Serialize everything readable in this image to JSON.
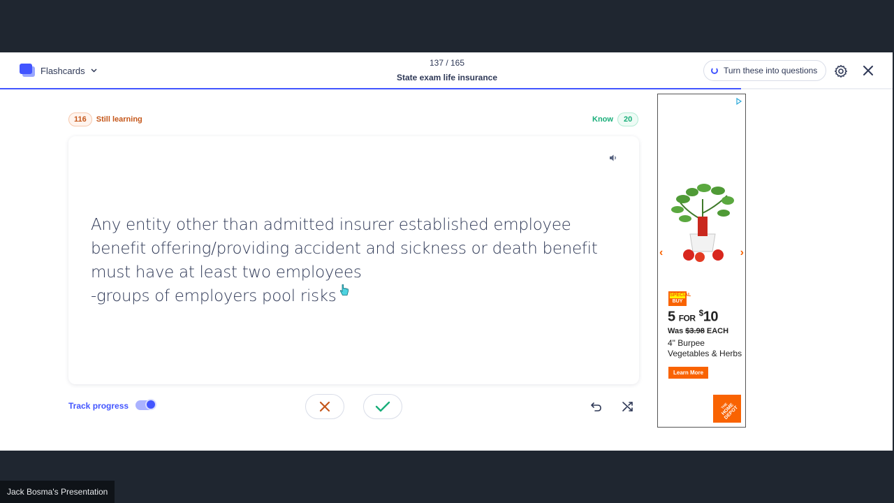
{
  "header": {
    "mode_label": "Flashcards",
    "counter": "137 / 165",
    "deck_title": "State exam life insurance",
    "turn_into_questions": "Turn these into questions",
    "progress_fraction": 0.83
  },
  "tally": {
    "still_learning_count": "116",
    "still_learning_label": "Still learning",
    "know_label": "Know",
    "know_count": "20"
  },
  "card": {
    "text": "Any entity other than admitted insurer established employee\nbenefit offering/providing accident and sickness or death benefit\nmust have at least two employees\n-groups of employers pool risks"
  },
  "footer": {
    "track_progress_label": "Track progress",
    "track_progress_on": true
  },
  "ad": {
    "special_top": "SPECIAL",
    "special_bottom": "BUY",
    "price_qty": "5",
    "price_for": "FOR",
    "price_currency": "$",
    "price_amount": "10",
    "was_label": "Was",
    "was_price": "$3.98",
    "was_suffix": "EACH",
    "product_line1": "4\" Burpee",
    "product_line2": "Vegetables & Herbs",
    "cta": "Learn More",
    "logo_text": "THE HOME DEPOT"
  },
  "presenter_label": "Jack Bosma's Presentation",
  "colors": {
    "accent": "#4255ff",
    "still_learning": "#c5571a",
    "know": "#18ae79",
    "ad_brand": "#f96302"
  }
}
